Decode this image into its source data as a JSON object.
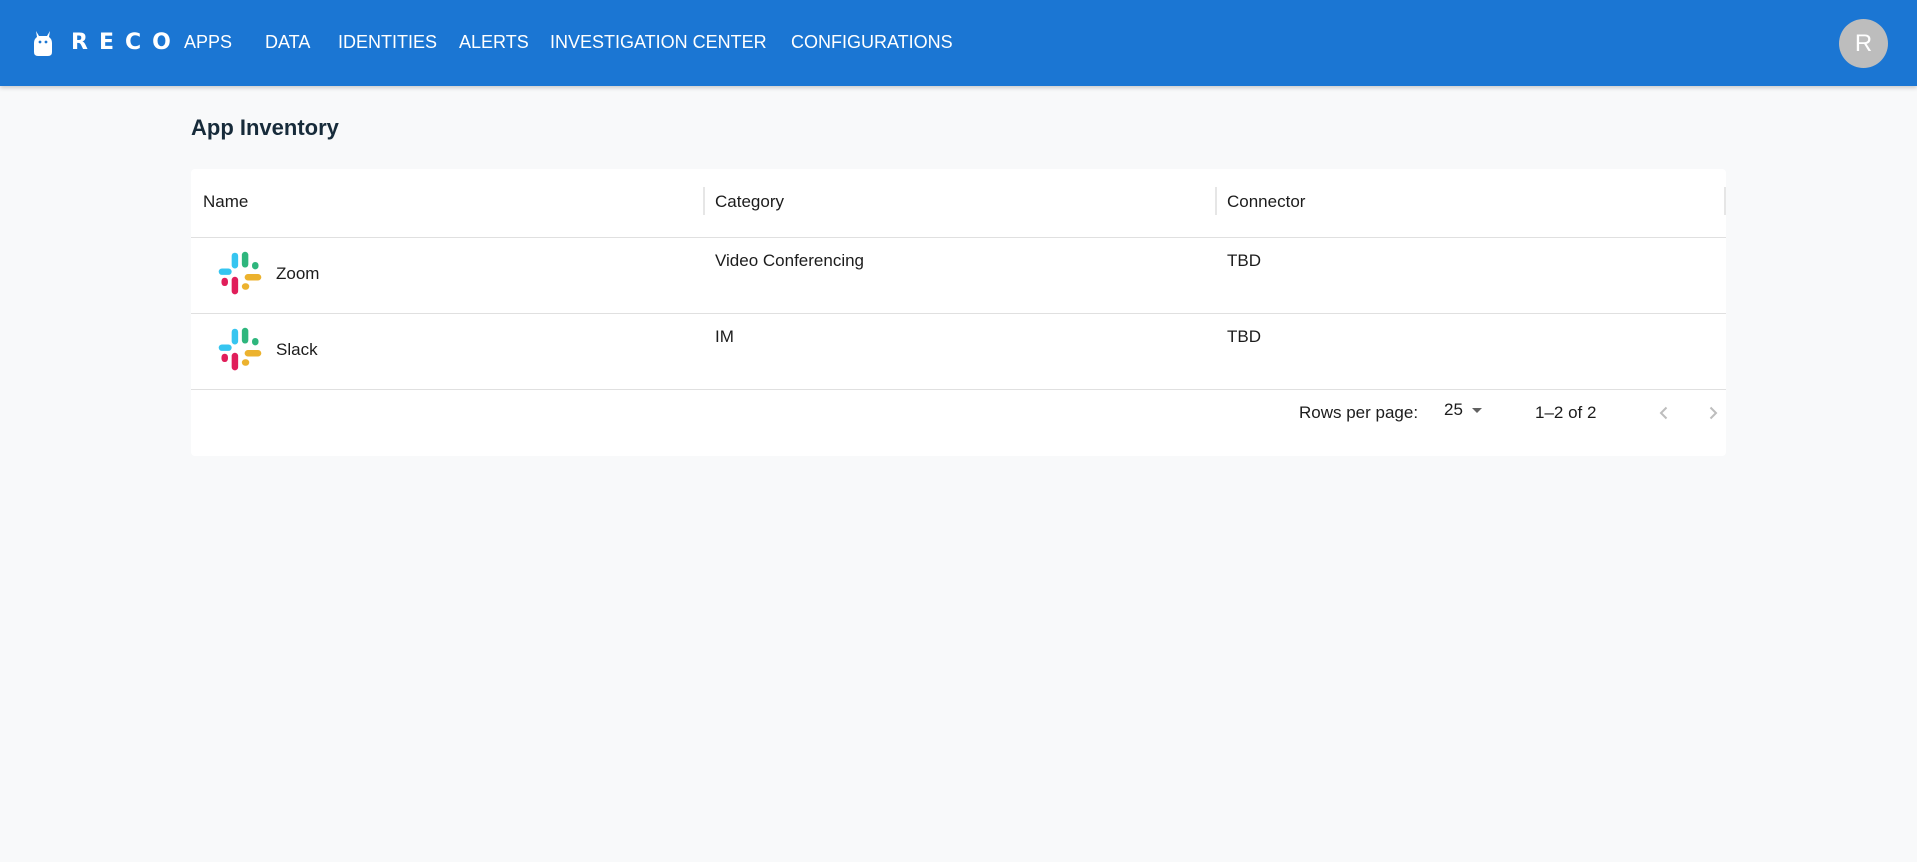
{
  "header": {
    "brand": "RECO",
    "nav": [
      {
        "label": "APPS"
      },
      {
        "label": "DATA"
      },
      {
        "label": "IDENTITIES"
      },
      {
        "label": "ALERTS"
      },
      {
        "label": "INVESTIGATION CENTER"
      },
      {
        "label": "CONFIGURATIONS"
      }
    ],
    "avatar_initial": "R",
    "colors": {
      "bar": "#1b76d3",
      "avatar": "#bdbdbd"
    }
  },
  "page": {
    "title": "App Inventory"
  },
  "table": {
    "columns": [
      "Name",
      "Category",
      "Connector"
    ],
    "rows": [
      {
        "name": "Zoom",
        "icon": "slack-logo-icon",
        "category": "Video Conferencing",
        "connector": "TBD"
      },
      {
        "name": "Slack",
        "icon": "slack-logo-icon",
        "category": "IM",
        "connector": "TBD"
      }
    ]
  },
  "pagination": {
    "rows_per_page_label": "Rows per page:",
    "rows_per_page": "25",
    "range": "1–2 of 2"
  }
}
